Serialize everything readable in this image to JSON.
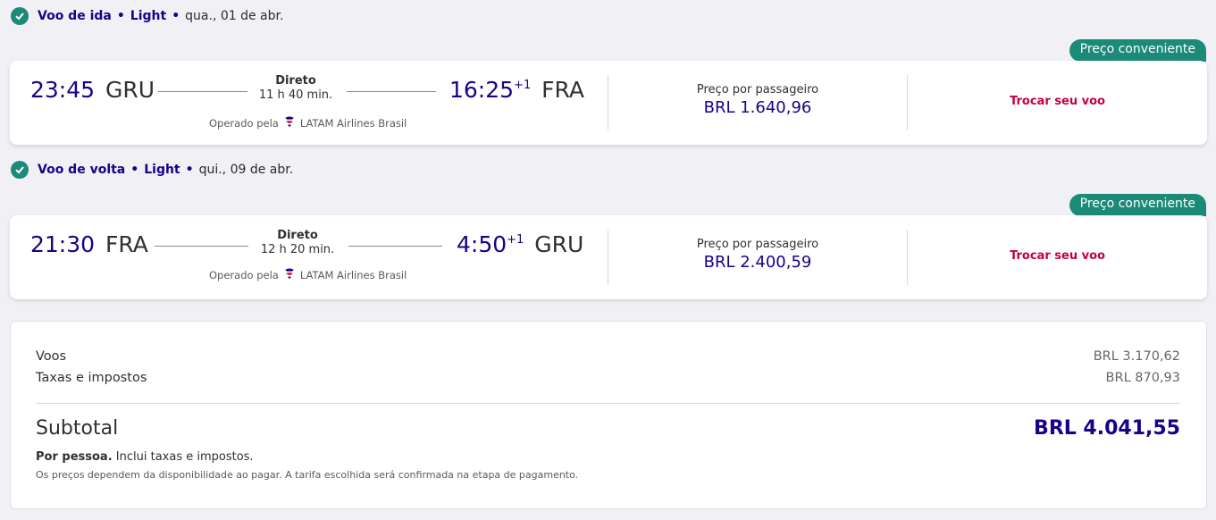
{
  "outbound": {
    "header": {
      "title": "Voo de ida",
      "fare": "Light",
      "date": "qua., 01 de abr."
    },
    "badge": "Preço conveniente",
    "dep_time": "23:45",
    "dep_code": "GRU",
    "stops": "Direto",
    "duration": "11 h 40 min.",
    "arr_time": "16:25",
    "arr_offset": "+1",
    "arr_code": "FRA",
    "operated_label": "Operado pela",
    "airline": "LATAM Airlines Brasil",
    "price_label": "Preço por passageiro",
    "price": "BRL 1.640,96",
    "change_label": "Trocar seu voo"
  },
  "return": {
    "header": {
      "title": "Voo de volta",
      "fare": "Light",
      "date": "qui., 09 de abr."
    },
    "badge": "Preço conveniente",
    "dep_time": "21:30",
    "dep_code": "FRA",
    "stops": "Direto",
    "duration": "12 h 20 min.",
    "arr_time": "4:50",
    "arr_offset": "+1",
    "arr_code": "GRU",
    "operated_label": "Operado pela",
    "airline": "LATAM Airlines Brasil",
    "price_label": "Preço por passageiro",
    "price": "BRL 2.400,59",
    "change_label": "Trocar seu voo"
  },
  "summary": {
    "flights_label": "Voos",
    "flights_value": "BRL 3.170,62",
    "taxes_label": "Taxas e impostos",
    "taxes_value": "BRL 870,93",
    "subtotal_label": "Subtotal",
    "subtotal_value": "BRL 4.041,55",
    "per_person_bold": "Por pessoa.",
    "per_person_text": "Inclui taxas e impostos.",
    "note": "Os preços dependem da disponibilidade ao pagar. A tarifa escolhida será confirmada na etapa de pagamento."
  },
  "colors": {
    "brand": "#1b0088",
    "accent_green": "#1b8a78",
    "link_red": "#c20041"
  },
  "icons": {
    "check": "check-circle-icon",
    "airline_logo": "latam-logo-icon"
  }
}
